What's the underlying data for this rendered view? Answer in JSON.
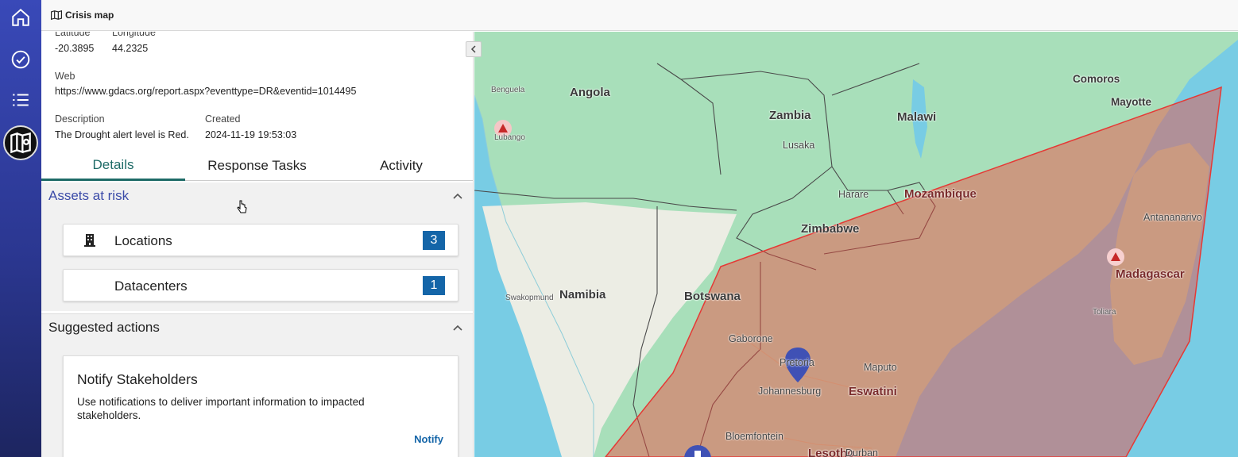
{
  "app": {
    "title": "Crisis map"
  },
  "rail": {
    "items": [
      "home",
      "tasks",
      "list",
      "map"
    ]
  },
  "details": {
    "latitude_label": "Latitude",
    "latitude": "-20.3895",
    "longitude_label": "Longitude",
    "longitude": "44.2325",
    "web_label": "Web",
    "web": "https://www.gdacs.org/report.aspx?eventtype=DR&eventid=1014495",
    "description_label": "Description",
    "description": "The Drought alert level is Red.",
    "created_label": "Created",
    "created": "2024-11-19 19:53:03"
  },
  "tabs": [
    {
      "label": "Details",
      "active": true
    },
    {
      "label": "Response Tasks",
      "active": false
    },
    {
      "label": "Activity",
      "active": false
    }
  ],
  "assets": {
    "title": "Assets at risk",
    "items": [
      {
        "label": "Locations",
        "count": "3",
        "icon": "building-icon"
      },
      {
        "label": "Datacenters",
        "count": "1",
        "icon": ""
      }
    ]
  },
  "suggested": {
    "title": "Suggested actions",
    "card": {
      "title": "Notify Stakeholders",
      "description": "Use notifications to deliver important information to impacted stakeholders.",
      "action": "Notify"
    }
  },
  "map": {
    "countries": [
      "Angola",
      "Zambia",
      "Malawi",
      "Mozambique",
      "Zimbabwe",
      "Namibia",
      "Botswana",
      "Madagascar",
      "Comoros",
      "Mayotte",
      "Eswatini",
      "Lesotho"
    ],
    "cities": [
      "Benguela",
      "Lubango",
      "Lusaka",
      "Harare",
      "Antananarivo",
      "Swakopmund",
      "Gaborone",
      "Pretoria",
      "Johannesburg",
      "Maputo",
      "Toliara",
      "Bloemfontein",
      "Durban"
    ],
    "colors": {
      "alert": "#e53935",
      "water": "#78cce4",
      "pin": "#3f51b5"
    }
  }
}
